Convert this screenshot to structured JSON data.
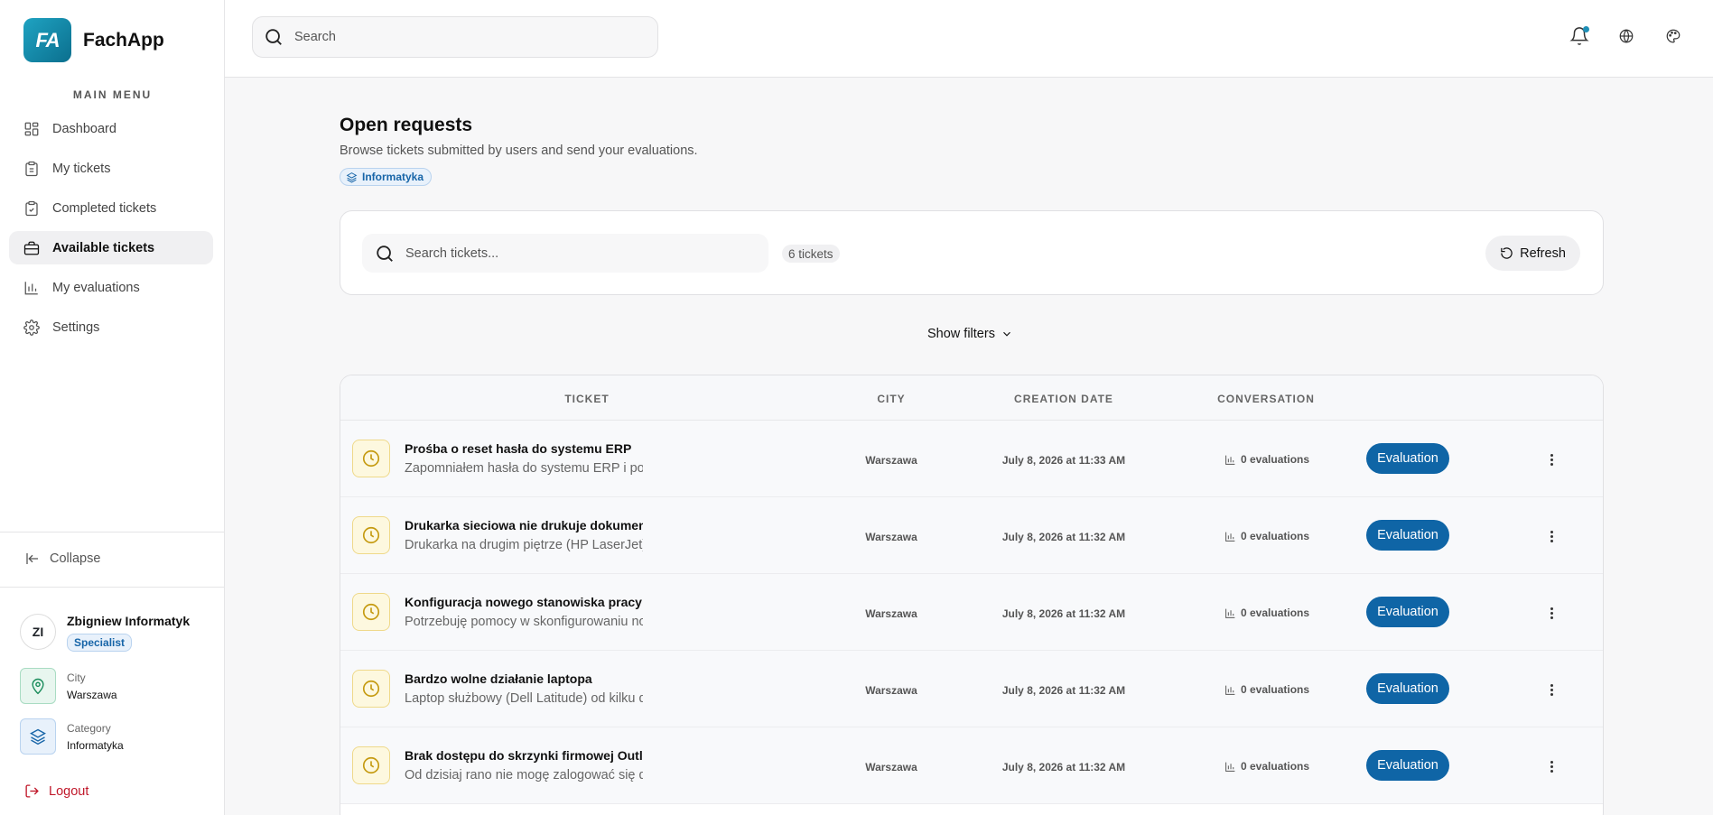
{
  "brand": {
    "logo_text": "FA",
    "name": "FachApp"
  },
  "sidebar": {
    "menu_title": "MAIN MENU",
    "items": [
      {
        "label": "Dashboard",
        "icon": "dashboard-icon"
      },
      {
        "label": "My tickets",
        "icon": "clipboard-icon"
      },
      {
        "label": "Completed tickets",
        "icon": "clipboard-check-icon"
      },
      {
        "label": "Available tickets",
        "icon": "briefcase-icon",
        "active": true
      },
      {
        "label": "My evaluations",
        "icon": "bar-chart-icon"
      },
      {
        "label": "Settings",
        "icon": "gear-icon"
      }
    ],
    "collapse_label": "Collapse",
    "user": {
      "initials": "ZI",
      "name": "Zbigniew Informatyk",
      "role": "Specialist"
    },
    "city": {
      "label": "City",
      "value": "Warszawa"
    },
    "category": {
      "label": "Category",
      "value": "Informatyka"
    },
    "logout_label": "Logout"
  },
  "header": {
    "search_placeholder": "Search"
  },
  "main": {
    "title": "Open requests",
    "subtitle": "Browse tickets submitted by users and send your evaluations.",
    "category_chip": "Informatyka",
    "ticket_search_placeholder": "Search tickets...",
    "ticket_count": "6 tickets",
    "refresh_label": "Refresh",
    "filters_label": "Show filters"
  },
  "table": {
    "columns": [
      "TICKET",
      "CITY",
      "CREATION DATE",
      "CONVERSATION"
    ],
    "rows": [
      {
        "title": "Prośba o reset hasła do systemu ERP",
        "desc": "Zapomniałem hasła do systemu ERP i potrzebuję resetu",
        "city": "Warszawa",
        "date": "July 8, 2026 at 11:33 AM",
        "evaluations": "0 evaluations",
        "action": "Evaluation"
      },
      {
        "title": "Drukarka sieciowa nie drukuje dokumentów",
        "desc": "Drukarka na drugim piętrze (HP LaserJet) nie odpowiada",
        "city": "Warszawa",
        "date": "July 8, 2026 at 11:32 AM",
        "evaluations": "0 evaluations",
        "action": "Evaluation"
      },
      {
        "title": "Konfiguracja nowego stanowiska pracy",
        "desc": "Potrzebuję pomocy w skonfigurowaniu nowego komputera",
        "city": "Warszawa",
        "date": "July 8, 2026 at 11:32 AM",
        "evaluations": "0 evaluations",
        "action": "Evaluation"
      },
      {
        "title": "Bardzo wolne działanie laptopa",
        "desc": "Laptop służbowy (Dell Latitude) od kilku dni działa wolno",
        "city": "Warszawa",
        "date": "July 8, 2026 at 11:32 AM",
        "evaluations": "0 evaluations",
        "action": "Evaluation"
      },
      {
        "title": "Brak dostępu do skrzynki firmowej Outlook",
        "desc": "Od dzisiaj rano nie mogę zalogować się do poczty",
        "city": "Warszawa",
        "date": "July 8, 2026 at 11:32 AM",
        "evaluations": "0 evaluations",
        "action": "Evaluation"
      }
    ]
  },
  "colors": {
    "accent": "#0f65a6",
    "brand": "#1593b5",
    "danger": "#c0182a",
    "pending": "#c59a10"
  }
}
